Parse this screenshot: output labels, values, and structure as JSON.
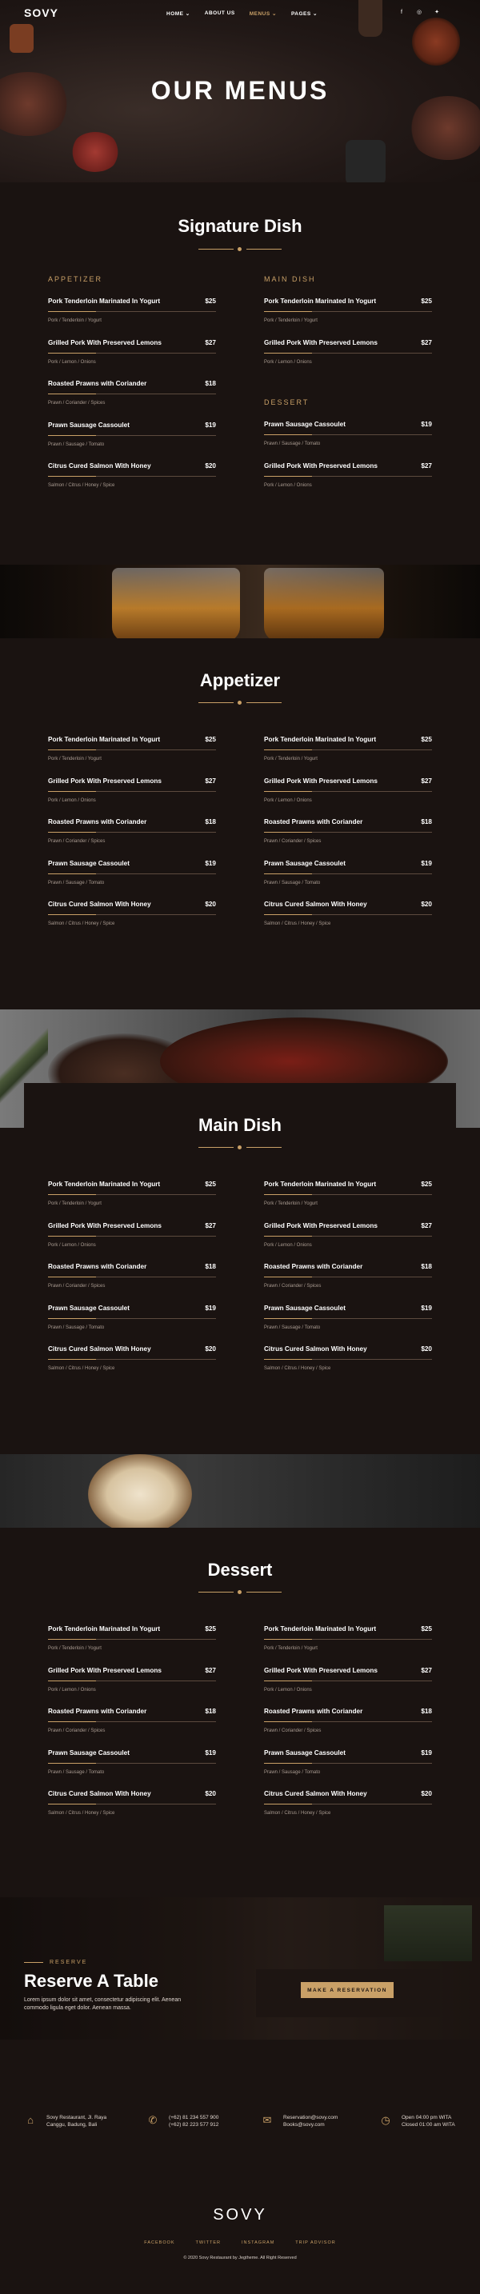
{
  "header": {
    "logo": "SOVY",
    "nav": [
      {
        "label": "HOME ⌄"
      },
      {
        "label": "ABOUT US"
      },
      {
        "label": "MENUS ⌄"
      },
      {
        "label": "PAGES ⌄"
      }
    ],
    "social": [
      {
        "icon": "facebook-icon",
        "glyph": "f"
      },
      {
        "icon": "instagram-icon",
        "glyph": "◎"
      },
      {
        "icon": "twitter-icon",
        "glyph": "✦"
      }
    ],
    "hero_title": "OUR MENUS"
  },
  "colors": {
    "accent": "#c9a067",
    "background": "#1a1311"
  },
  "signature": {
    "title": "Signature Dish",
    "categories": {
      "appetizer": "APPETIZER",
      "main": "MAIN DISH",
      "dessert": "DESSERT"
    },
    "appetizer_items": [
      {
        "name": "Pork Tenderloin Marinated In Yogurt",
        "price": "$25",
        "desc": "Pork / Tenderloin / Yogurt"
      },
      {
        "name": "Grilled Pork With Preserved Lemons",
        "price": "$27",
        "desc": "Pork / Lemon / Onions"
      },
      {
        "name": "Roasted Prawns with Coriander",
        "price": "$18",
        "desc": "Prawn / Coriander / Spices"
      },
      {
        "name": "Prawn Sausage Cassoulet",
        "price": "$19",
        "desc": "Prawn / Sausage / Tomato"
      },
      {
        "name": "Citrus Cured Salmon With Honey",
        "price": "$20",
        "desc": "Salmon / Citrus / Honey / Spice"
      }
    ],
    "main_items": [
      {
        "name": "Pork Tenderloin Marinated In Yogurt",
        "price": "$25",
        "desc": "Pork / Tenderloin / Yogurt"
      },
      {
        "name": "Grilled Pork With Preserved Lemons",
        "price": "$27",
        "desc": "Pork / Lemon / Onions"
      }
    ],
    "dessert_items": [
      {
        "name": "Prawn Sausage Cassoulet",
        "price": "$19",
        "desc": "Prawn / Sausage / Tomato"
      },
      {
        "name": "Grilled Pork With Preserved Lemons",
        "price": "$27",
        "desc": "Pork / Lemon / Onions"
      }
    ]
  },
  "appetizer": {
    "title": "Appetizer",
    "left": [
      {
        "name": "Pork Tenderloin Marinated In Yogurt",
        "price": "$25",
        "desc": "Pork / Tenderloin / Yogurt"
      },
      {
        "name": "Grilled Pork With Preserved Lemons",
        "price": "$27",
        "desc": "Pork / Lemon / Onions"
      },
      {
        "name": "Roasted Prawns with Coriander",
        "price": "$18",
        "desc": "Prawn / Coriander / Spices"
      },
      {
        "name": "Prawn Sausage Cassoulet",
        "price": "$19",
        "desc": "Prawn / Sausage / Tomato"
      },
      {
        "name": "Citrus Cured Salmon With Honey",
        "price": "$20",
        "desc": "Salmon / Citrus / Honey / Spice"
      }
    ],
    "right": [
      {
        "name": "Pork Tenderloin Marinated In Yogurt",
        "price": "$25",
        "desc": "Pork / Tenderloin / Yogurt"
      },
      {
        "name": "Grilled Pork With Preserved Lemons",
        "price": "$27",
        "desc": "Pork / Lemon / Onions"
      },
      {
        "name": "Roasted Prawns with Coriander",
        "price": "$18",
        "desc": "Prawn / Coriander / Spices"
      },
      {
        "name": "Prawn Sausage Cassoulet",
        "price": "$19",
        "desc": "Prawn / Sausage / Tomato"
      },
      {
        "name": "Citrus Cured Salmon With Honey",
        "price": "$20",
        "desc": "Salmon / Citrus / Honey / Spice"
      }
    ]
  },
  "main_dish": {
    "title": "Main Dish",
    "left": [
      {
        "name": "Pork Tenderloin Marinated In Yogurt",
        "price": "$25",
        "desc": "Pork / Tenderloin / Yogurt"
      },
      {
        "name": "Grilled Pork With Preserved Lemons",
        "price": "$27",
        "desc": "Pork / Lemon / Onions"
      },
      {
        "name": "Roasted Prawns with Coriander",
        "price": "$18",
        "desc": "Prawn / Coriander / Spices"
      },
      {
        "name": "Prawn Sausage Cassoulet",
        "price": "$19",
        "desc": "Prawn / Sausage / Tomato"
      },
      {
        "name": "Citrus Cured Salmon With Honey",
        "price": "$20",
        "desc": "Salmon / Citrus / Honey / Spice"
      }
    ],
    "right": [
      {
        "name": "Pork Tenderloin Marinated In Yogurt",
        "price": "$25",
        "desc": "Pork / Tenderloin / Yogurt"
      },
      {
        "name": "Grilled Pork With Preserved Lemons",
        "price": "$27",
        "desc": "Pork / Lemon / Onions"
      },
      {
        "name": "Roasted Prawns with Coriander",
        "price": "$18",
        "desc": "Prawn / Coriander / Spices"
      },
      {
        "name": "Prawn Sausage Cassoulet",
        "price": "$19",
        "desc": "Prawn / Sausage / Tomato"
      },
      {
        "name": "Citrus Cured Salmon With Honey",
        "price": "$20",
        "desc": "Salmon / Citrus / Honey / Spice"
      }
    ]
  },
  "dessert": {
    "title": "Dessert",
    "left": [
      {
        "name": "Pork Tenderloin Marinated In Yogurt",
        "price": "$25",
        "desc": "Pork / Tenderloin / Yogurt"
      },
      {
        "name": "Grilled Pork With Preserved Lemons",
        "price": "$27",
        "desc": "Pork / Lemon / Onions"
      },
      {
        "name": "Roasted Prawns with Coriander",
        "price": "$18",
        "desc": "Prawn / Coriander / Spices"
      },
      {
        "name": "Prawn Sausage Cassoulet",
        "price": "$19",
        "desc": "Prawn / Sausage / Tomato"
      },
      {
        "name": "Citrus Cured Salmon With Honey",
        "price": "$20",
        "desc": "Salmon / Citrus / Honey / Spice"
      }
    ],
    "right": [
      {
        "name": "Pork Tenderloin Marinated In Yogurt",
        "price": "$25",
        "desc": "Pork / Tenderloin / Yogurt"
      },
      {
        "name": "Grilled Pork With Preserved Lemons",
        "price": "$27",
        "desc": "Pork / Lemon / Onions"
      },
      {
        "name": "Roasted Prawns with Coriander",
        "price": "$18",
        "desc": "Prawn / Coriander / Spices"
      },
      {
        "name": "Prawn Sausage Cassoulet",
        "price": "$19",
        "desc": "Prawn / Sausage / Tomato"
      },
      {
        "name": "Citrus Cured Salmon With Honey",
        "price": "$20",
        "desc": "Salmon / Citrus / Honey / Spice"
      }
    ]
  },
  "reserve": {
    "kicker": "RESERVE",
    "title": "Reserve A Table",
    "text": "Lorem ipsum dolor sit amet, consectetur adipiscing elit. Aenean commodo ligula eget dolor. Aenean massa.",
    "button": "MAKE A RESERVATION"
  },
  "contact": [
    {
      "icon": "map-icon",
      "glyph": "⌂",
      "line1": "Sovy Restaurant, Jl. Raya",
      "line2": "Canggu, Badung, Bali"
    },
    {
      "icon": "phone-icon",
      "glyph": "✆",
      "line1": "(+62) 81 234 557 900",
      "line2": "(+62) 82 223 577 912"
    },
    {
      "icon": "mail-icon",
      "glyph": "✉",
      "line1": "Reservation@sovy.com",
      "line2": "Books@sovy.com"
    },
    {
      "icon": "clock-icon",
      "glyph": "◷",
      "line1": "Open 04:00 pm WITA",
      "line2": "Closed 01:00 am WITA"
    }
  ],
  "footer": {
    "logo": "SOVY",
    "links": [
      "FACEBOOK",
      "TWITTER",
      "INSTAGRAM",
      "TRIP ADVISOR"
    ],
    "copyright": "© 2020 Sovy Restaurant by Jegtheme. All Right Reserved"
  }
}
